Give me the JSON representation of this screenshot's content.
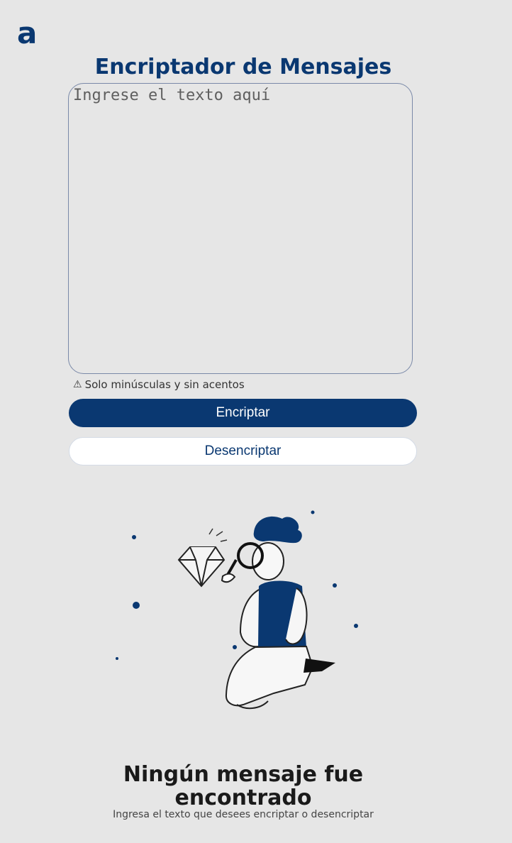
{
  "header": {
    "logo_text": "a",
    "title": "Encriptador de Mensajes"
  },
  "input": {
    "placeholder": "Ingrese el texto aquí",
    "value": ""
  },
  "hint": {
    "icon": "warning-icon",
    "text": "Solo minúsculas y sin acentos"
  },
  "buttons": {
    "encrypt_label": "Encriptar",
    "decrypt_label": "Desencriptar"
  },
  "empty_state": {
    "title": "Ningún mensaje fue encontrado",
    "subtitle": "Ingresa el texto que desees encriptar o desencriptar"
  },
  "colors": {
    "background": "#e6e6e6",
    "primary": "#0a3871",
    "white": "#ffffff"
  }
}
